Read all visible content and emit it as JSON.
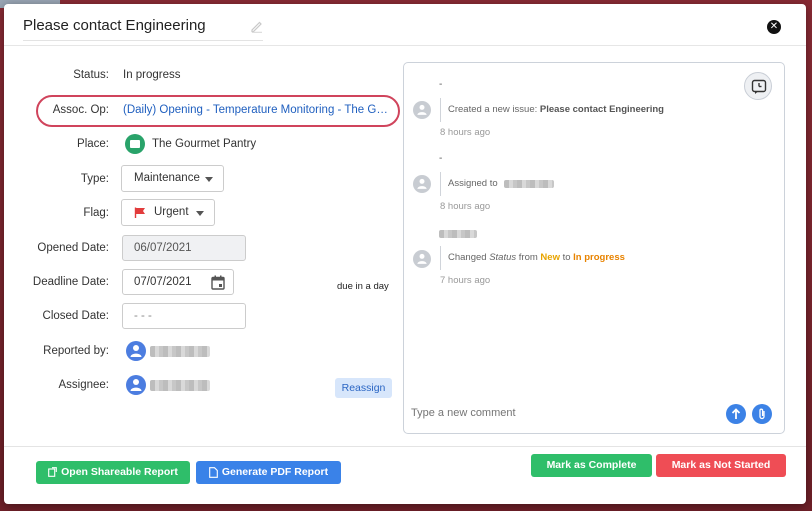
{
  "issue": {
    "title": "Please contact Engineering"
  },
  "details": {
    "status_label": "Status:",
    "status_value": "In progress",
    "assoc_label": "Assoc. Op:",
    "assoc_value": "(Daily) Opening - Temperature Monitoring - The Gourmet Pantry",
    "place_label": "Place:",
    "place_value": "The Gourmet Pantry",
    "type_label": "Type:",
    "type_value": "Maintenance",
    "flag_label": "Flag:",
    "flag_value": "Urgent",
    "opened_label": "Opened Date:",
    "opened_value": "06/07/2021",
    "deadline_label": "Deadline Date:",
    "deadline_value": "07/07/2021",
    "due_text": "due in a day",
    "closed_label": "Closed Date:",
    "closed_value": "- - -",
    "reported_label": "Reported by:",
    "assignee_label": "Assignee:",
    "reassign_label": "Reassign"
  },
  "activity": {
    "entries": [
      {
        "dash": "-",
        "prefix": "Created a new issue: ",
        "bold": "Please contact Engineering",
        "time": "8 hours ago"
      },
      {
        "dash": "-",
        "prefix": "Assigned to",
        "time": "8 hours ago"
      },
      {
        "changed": "Changed ",
        "field": "Status",
        "from": " from ",
        "old_value": "New",
        "to": " to ",
        "new_value": "In progress",
        "time": "7 hours ago"
      }
    ],
    "comment_placeholder": "Type a new comment"
  },
  "footer": {
    "open_report_label": "Open Shareable Report",
    "pdf_report_label": "Generate PDF Report",
    "complete_label": "Mark as Complete",
    "not_started_label": "Mark as Not Started"
  },
  "colors": {
    "assoc_highlight": "#d0445c",
    "link": "#1f5fbf",
    "green": "#2fbe6a",
    "blue": "#3a82e8",
    "red": "#ef4d55",
    "status_new": "#e8a400",
    "status_in_progress": "#e88300"
  },
  "icons": [
    "edit-icon",
    "close-icon",
    "store-icon",
    "flag-icon",
    "calendar-icon",
    "user-icon",
    "history-icon",
    "upload-icon",
    "attachment-icon",
    "external-link-icon",
    "document-icon"
  ]
}
